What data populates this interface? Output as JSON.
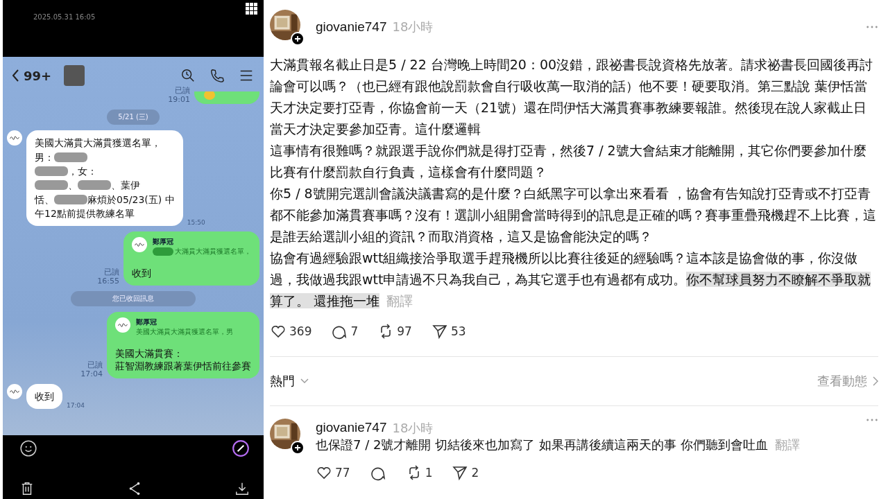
{
  "chat_screen": {
    "status_time": "2025.05.31 16:05",
    "header": {
      "back_count": "99+"
    },
    "messages": [
      {
        "kind": "sent",
        "read": "已讀",
        "time": "19:01"
      },
      {
        "kind": "date",
        "text": "5/21 (三)"
      },
      {
        "kind": "received",
        "lines": [
          [
            {
              "kind": "text",
              "text": "美國大滿貫大滿貫獲選名單，"
            }
          ],
          [
            {
              "kind": "text",
              "text": "男："
            },
            {
              "kind": "redacted"
            }
          ],
          [
            {
              "kind": "redacted"
            },
            {
              "kind": "text",
              "text": "，女："
            }
          ],
          [
            {
              "kind": "redacted"
            },
            {
              "kind": "text",
              "text": "、"
            },
            {
              "kind": "redacted"
            },
            {
              "kind": "text",
              "text": "、葉伊"
            }
          ],
          [
            {
              "kind": "text",
              "text": "恬、"
            },
            {
              "kind": "redacted"
            },
            {
              "kind": "text",
              "text": "麻煩於05/23(五) 中"
            }
          ],
          [
            {
              "kind": "text",
              "text": "午12點前提供教練名單"
            }
          ]
        ],
        "time": "15:50"
      },
      {
        "kind": "sent",
        "quote": {
          "name": "鄭厚冠",
          "text": "大滿貫大滿貫獲選名單，",
          "redacted": true
        },
        "text": [
          "收到"
        ],
        "read": "已讀",
        "time": "16:55"
      },
      {
        "kind": "system",
        "text": "您已收回訊息"
      },
      {
        "kind": "sent",
        "quote": {
          "name": "鄭厚冠",
          "text": "美國大滿貫大滿貫獲選名單，男",
          "redacted": false
        },
        "text": [
          "美國大滿貫賽：",
          "莊智淵教練跟著葉伊恬前往參賽"
        ],
        "read": "已讀",
        "time": "17:04"
      },
      {
        "kind": "received",
        "lines": [
          [
            {
              "kind": "text",
              "text": "收到"
            }
          ]
        ],
        "time": "17:04"
      }
    ]
  },
  "threads_screen": {
    "post": {
      "username": "giovanie747",
      "time": "18小時",
      "paragraphs": [
        [
          {
            "text": "大滿貫報名截止日是5 / 22 台灣晚上時間20：00沒錯，跟祕書長說資格先放著。請求祕書長回國後再討論會可以嗎？（也已經有跟他說罰款會自行吸收萬一取消的話）他不要！硬要取消。第三點說 葉伊恬當天才決定要打亞青，你協會前一天（21號）還在問伊恬大滿貫賽事教練要報誰。然後現在說人家截止日當天才決定要參加亞青。這什麼邏輯",
            "highlighted": false
          }
        ],
        [
          {
            "text": "這事情有很難嗎？就跟選手說你們就是得打亞青，然後7 / 2號大會結束才能離開，其它你們要參加什麼比賽有什麼罰款自行負責，這樣會有什麼問題？",
            "highlighted": false
          }
        ],
        [
          {
            "text": "你5 / 8號開完選訓會議決議書寫的是什麼？白紙黑字可以拿出來看看 ，協會有告知說打亞青或不打亞青都不能參加滿貫賽事嗎？沒有！選訓小組開會當時得到的訊息是正確的嗎？賽事重疊飛機趕不上比賽，這是誰丟給選訓小組的資訊？而取消資格，這又是協會能決定的嗎？",
            "highlighted": false
          }
        ],
        [
          {
            "text": "協會有過經驗跟wtt組織接洽爭取選手趕飛機所以比賽往後延的經驗嗎？這本該是協會做的事，你沒做過，我做過我跟wtt申請過不只為我自己，為其它選手也有過都有成功。",
            "highlighted": false
          },
          {
            "text": "你不幫球員努力不瞭解不爭取就算了。 還推拖一堆",
            "highlighted": true
          }
        ]
      ],
      "translate": "翻譯",
      "likes": "369",
      "replies": "7",
      "reposts": "97",
      "shares": "53"
    },
    "sort": {
      "label": "熱門",
      "activity": "查看動態"
    },
    "reply": {
      "username": "giovanie747",
      "time": "18小時",
      "text": "也保證7 / 2號才離開 切結後來也加寫了 如果再講後續這兩天的事 你們聽到會吐血",
      "translate": "翻譯",
      "likes": "77",
      "reposts": "1",
      "shares": "2"
    }
  }
}
